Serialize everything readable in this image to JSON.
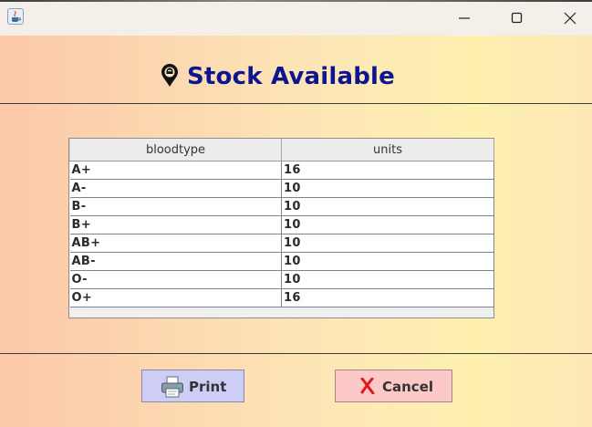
{
  "window": {
    "title": "",
    "controls": [
      "minimize-icon",
      "maximize-icon",
      "close-icon"
    ]
  },
  "header": {
    "title": "Stock Available",
    "icon": "blood-drop-marker-icon",
    "title_color": "#0d1590"
  },
  "table": {
    "columns": [
      "bloodtype",
      "units"
    ],
    "rows": [
      [
        "A+",
        "16"
      ],
      [
        "A-",
        "10"
      ],
      [
        "B-",
        "10"
      ],
      [
        "B+",
        "10"
      ],
      [
        "AB+",
        "10"
      ],
      [
        "AB-",
        "10"
      ],
      [
        "O-",
        "10"
      ],
      [
        "O+",
        "16"
      ]
    ]
  },
  "buttons": {
    "print": {
      "label": "Print",
      "icon": "printer-icon",
      "color": "#cecdf5"
    },
    "cancel": {
      "label": "Cancel",
      "icon": "red-x-icon",
      "color": "#fcc8c8"
    }
  }
}
